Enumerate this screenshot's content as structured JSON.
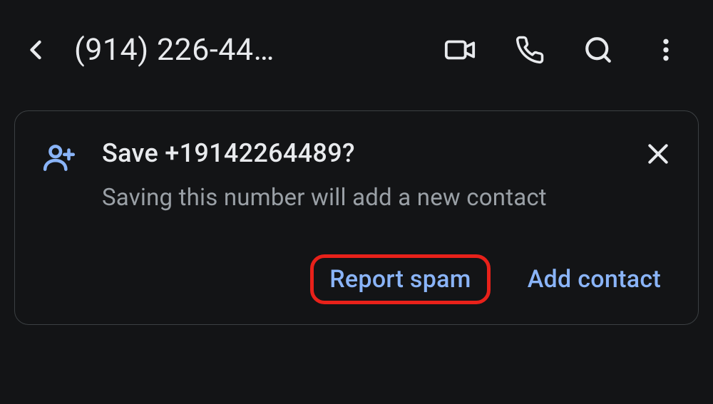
{
  "header": {
    "title": "(914) 226-44…"
  },
  "card": {
    "title": "Save +19142264489?",
    "subtitle": "Saving this number will add a new contact",
    "report_spam_label": "Report spam",
    "add_contact_label": "Add contact"
  }
}
